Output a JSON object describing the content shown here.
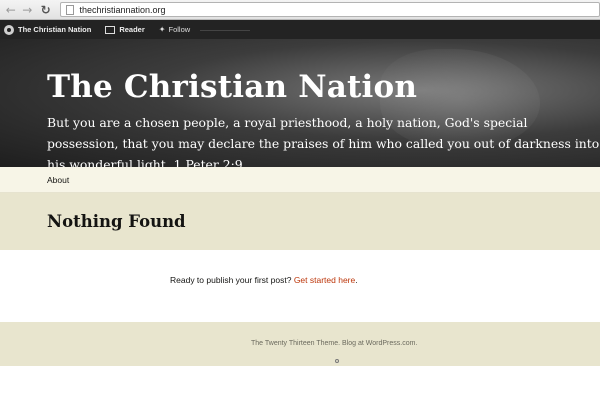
{
  "browser": {
    "url": "thechristiannation.org",
    "back_icon": "back-arrow-icon",
    "forward_icon": "forward-arrow-icon",
    "reload_icon": "reload-icon"
  },
  "toolbar": {
    "site_name": "The Christian Nation",
    "reader_label": "Reader",
    "follow_label": "Follow"
  },
  "header": {
    "title": "The Christian Nation",
    "description": "But you are a chosen people, a royal priesthood, a holy nation, God's special possession, that you may declare the praises of him who called you out of darkness into his wonderful light. 1 Peter 2:9"
  },
  "nav": {
    "items": [
      {
        "label": "About"
      }
    ]
  },
  "main": {
    "title": "Nothing Found",
    "prompt_text": "Ready to publish your first post?",
    "link_text": "Get started here",
    "trailing": "."
  },
  "footer": {
    "text": "The Twenty Thirteen Theme. Blog at WordPress.com."
  },
  "colors": {
    "toolbar_bg": "#232323",
    "nav_bg": "#f7f5e7",
    "band_bg": "#e8e5ce",
    "link": "#bc360a"
  }
}
